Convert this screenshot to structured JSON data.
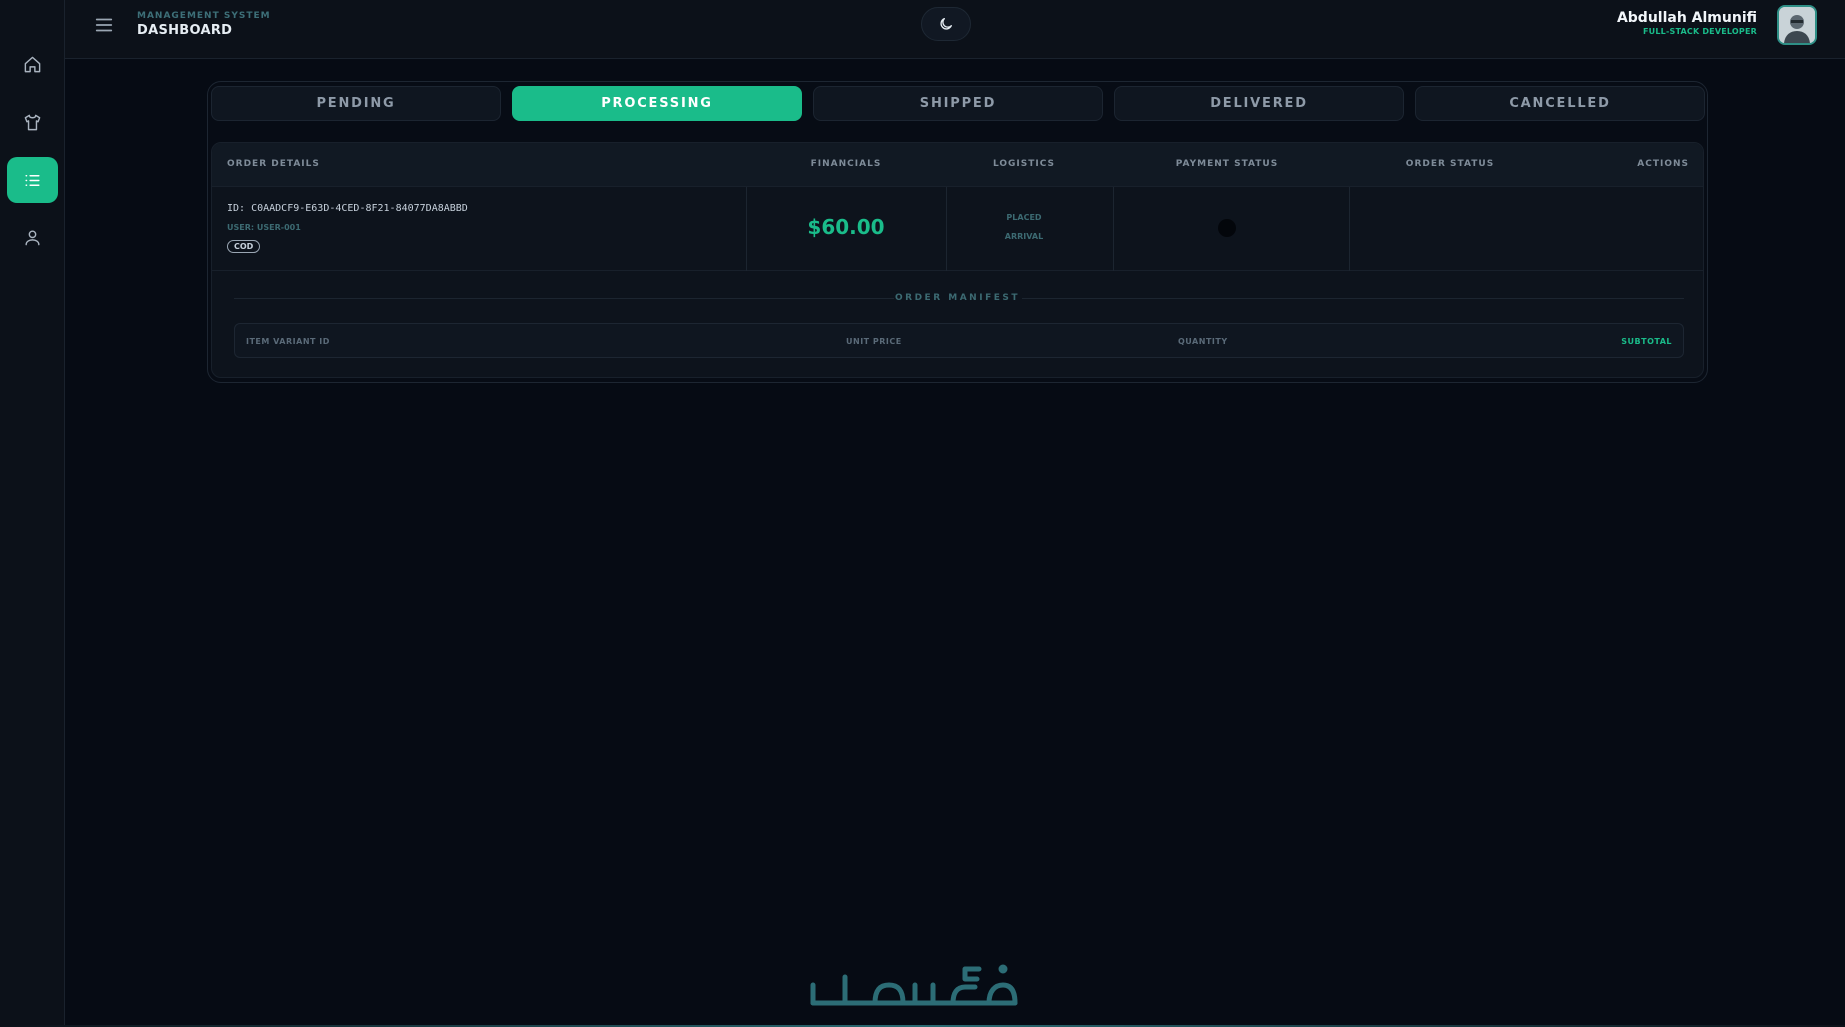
{
  "sidebar": {
    "items": [
      {
        "icon": "home-icon"
      },
      {
        "icon": "shirt-icon"
      },
      {
        "icon": "list-icon",
        "active": true
      },
      {
        "icon": "user-icon"
      }
    ]
  },
  "header": {
    "subtitle": "MANAGEMENT SYSTEM",
    "title": "DASHBOARD",
    "theme_icon": "moon-icon",
    "user": {
      "name": "Abdullah Almunifi",
      "role": "FULL-STACK DEVELOPER"
    }
  },
  "tabs": [
    {
      "label": "PENDING"
    },
    {
      "label": "PROCESSING",
      "active": true
    },
    {
      "label": "SHIPPED"
    },
    {
      "label": "DELIVERED"
    },
    {
      "label": "CANCELLED"
    }
  ],
  "table": {
    "headers": {
      "order_details": "ORDER DETAILS",
      "financials": "FINANCIALS",
      "logistics": "LOGISTICS",
      "payment_status": "PAYMENT STATUS",
      "order_status": "ORDER STATUS",
      "actions": "ACTIONS"
    },
    "rows": [
      {
        "id": "ID: C0AADCF9-E63D-4CED-8F21-84077DA8ABBD",
        "user": "USER: USER-001",
        "payment_method": "COD",
        "total": "$60.00",
        "placed": "PLACED",
        "arrival": "ARRIVAL"
      }
    ]
  },
  "manifest": {
    "title": "ORDER MANIFEST",
    "headers": {
      "item_variant_id": "ITEM VARIANT ID",
      "unit_price": "UNIT PRICE",
      "quantity": "QUANTITY",
      "subtotal": "SUBTOTAL"
    }
  },
  "colors": {
    "accent": "#1abc8a",
    "background": "#060b14",
    "panel": "#0c1119"
  }
}
